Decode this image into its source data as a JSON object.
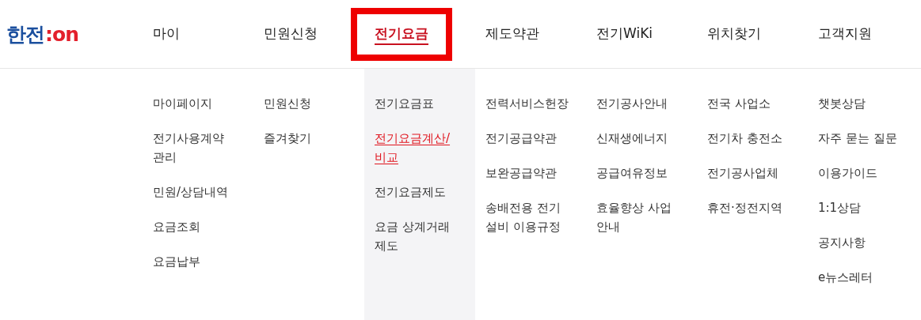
{
  "logo": {
    "text": "한전",
    "mark": ":on"
  },
  "nav": [
    {
      "label": "마이",
      "selected": false
    },
    {
      "label": "민원신청",
      "selected": false
    },
    {
      "label": "전기요금",
      "selected": true
    },
    {
      "label": "제도약관",
      "selected": false
    },
    {
      "label": "전기WiKi",
      "selected": false
    },
    {
      "label": "위치찾기",
      "selected": false
    },
    {
      "label": "고객지원",
      "selected": false
    }
  ],
  "menu_columns": [
    {
      "items": [
        {
          "label": "마이페이지",
          "selected": false
        },
        {
          "label": "전기사용계약 관리",
          "selected": false
        },
        {
          "label": "민원/상담내역",
          "selected": false
        },
        {
          "label": "요금조회",
          "selected": false
        },
        {
          "label": "요금납부",
          "selected": false
        }
      ]
    },
    {
      "items": [
        {
          "label": "민원신청",
          "selected": false
        },
        {
          "label": "즐겨찾기",
          "selected": false
        }
      ]
    },
    {
      "items": [
        {
          "label": "전기요금표",
          "selected": false
        },
        {
          "label": "전기요금계산/비교",
          "selected": true
        },
        {
          "label": "전기요금제도",
          "selected": false
        },
        {
          "label": "요금 상계거래 제도",
          "selected": false
        }
      ]
    },
    {
      "items": [
        {
          "label": "전력서비스헌장",
          "selected": false
        },
        {
          "label": "전기공급약관",
          "selected": false
        },
        {
          "label": "보완공급약관",
          "selected": false
        },
        {
          "label": "송배전용 전기 설비 이용규정",
          "selected": false
        }
      ]
    },
    {
      "items": [
        {
          "label": "전기공사안내",
          "selected": false
        },
        {
          "label": "신재생에너지",
          "selected": false
        },
        {
          "label": "공급여유정보",
          "selected": false
        },
        {
          "label": "효율향상 사업 안내",
          "selected": false
        }
      ]
    },
    {
      "items": [
        {
          "label": "전국 사업소",
          "selected": false
        },
        {
          "label": "전기차 충전소",
          "selected": false
        },
        {
          "label": "전기공사업체",
          "selected": false
        },
        {
          "label": "휴전·정전지역",
          "selected": false
        }
      ]
    },
    {
      "items": [
        {
          "label": "챗봇상담",
          "selected": false
        },
        {
          "label": "자주 묻는 질문",
          "selected": false
        },
        {
          "label": "이용가이드",
          "selected": false
        },
        {
          "label": "1:1상담",
          "selected": false
        },
        {
          "label": "공지사항",
          "selected": false
        },
        {
          "label": "e뉴스레터",
          "selected": false
        }
      ]
    }
  ]
}
